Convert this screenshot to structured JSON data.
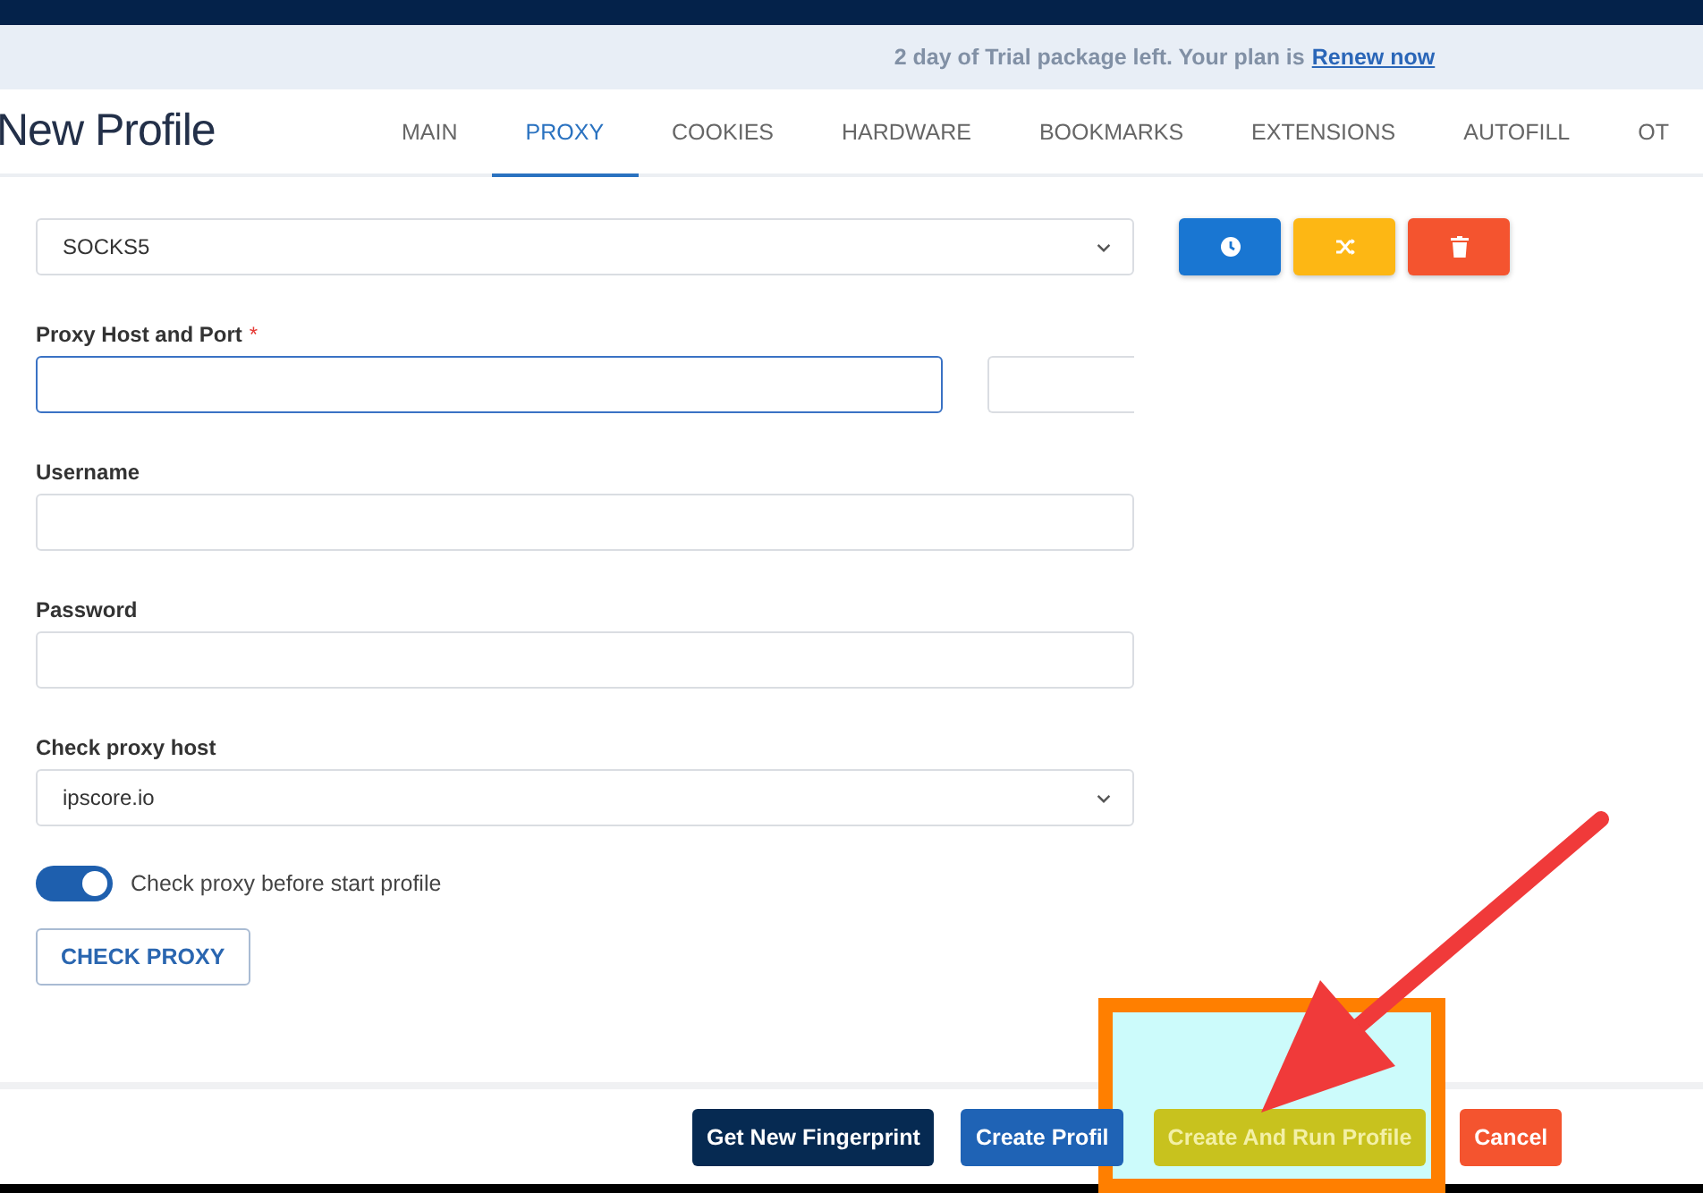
{
  "banner": {
    "text": "2 day of Trial package left. Your plan is",
    "link": "Renew now"
  },
  "title": "New Profile",
  "tabs": [
    {
      "label": "MAIN",
      "selected": false
    },
    {
      "label": "PROXY",
      "selected": true
    },
    {
      "label": "COOKIES",
      "selected": false
    },
    {
      "label": "HARDWARE",
      "selected": false
    },
    {
      "label": "BOOKMARKS",
      "selected": false
    },
    {
      "label": "EXTENSIONS",
      "selected": false
    },
    {
      "label": "AUTOFILL",
      "selected": false
    },
    {
      "label": "OT",
      "selected": false
    }
  ],
  "proxy_type": {
    "value": "SOCKS5"
  },
  "fields": [
    {
      "label": "Proxy Host and Port",
      "required_mark": "*",
      "focused": true,
      "kind": "hostport"
    },
    {
      "label": "Username",
      "kind": "text"
    },
    {
      "label": "Password",
      "kind": "text"
    },
    {
      "label": "Check proxy host",
      "kind": "select",
      "value": "ipscore.io"
    }
  ],
  "toggle": {
    "label": "Check proxy before start profile",
    "on": true
  },
  "check_button": "CHECK PROXY",
  "footer_buttons": [
    {
      "label": "Get New Fingerprint",
      "kind": "dark"
    },
    {
      "label": "Create Profil",
      "kind": "primary"
    },
    {
      "label": "Create And Run Profile",
      "kind": "highlight"
    },
    {
      "label": "Cancel",
      "kind": "danger"
    }
  ]
}
